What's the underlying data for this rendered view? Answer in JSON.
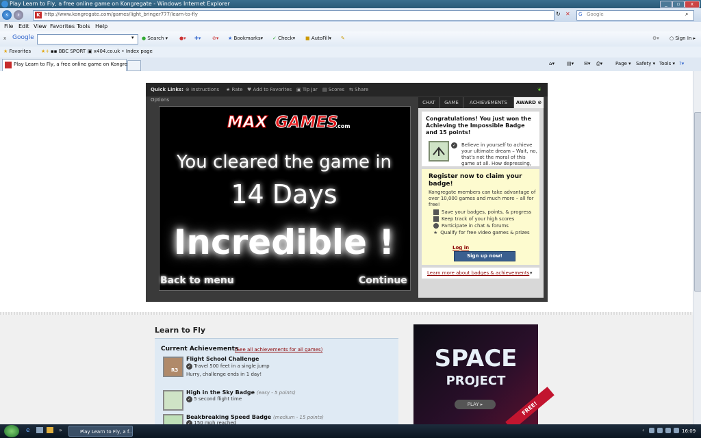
{
  "window": {
    "title": "Play Learn to Fly, a free online game on Kongregate - Windows Internet Explorer"
  },
  "address_bar": {
    "url": "http://www.kongregate.com/games/light_bringer777/learn-to-fly",
    "search_placeholder": "Google"
  },
  "menu": [
    "File",
    "Edit",
    "View",
    "Favorites",
    "Tools",
    "Help"
  ],
  "google_toolbar": {
    "brand": "Google",
    "search_label": "Search",
    "bookmarks_label": "Bookmarks",
    "check_label": "Check",
    "autofill_label": "AutoFill",
    "signin_label": "Sign In"
  },
  "favorites_bar": {
    "favorites_label": "Favorites",
    "links": [
      "BBC SPORT",
      "x404.co.uk • Index page"
    ]
  },
  "tabs": {
    "active_label": "Play Learn to Fly, a free online game on Kongreg...",
    "commands": [
      "Page",
      "Safety",
      "Tools"
    ]
  },
  "quick_links": {
    "label": "Quick Links:",
    "items": [
      "Instructions",
      "Rate",
      "Add to Favorites",
      "Tip Jar",
      "Scores",
      "Share"
    ],
    "options_label": "Options"
  },
  "game": {
    "logo_left": "MAX",
    "logo_right": "GAMES",
    "logo_suffix": ".com",
    "cleared_text": "You cleared the game in",
    "days_text": "14 Days",
    "incredible_text": "Incredible !",
    "back_label": "Back to menu",
    "continue_label": "Continue"
  },
  "side_panel": {
    "tabs": [
      "CHAT",
      "GAME",
      "ACHIEVEMENTS",
      "AWARD"
    ],
    "congrats_heading": "Congratulations! You just won the Achieving the Impossible Badge and 15 points!",
    "badge_desc": "Believe in yourself to achieve your ultimate dream – Wait, no, that's not the moral of this game at all. How depressing,",
    "register_heading": "Register now to claim your badge!",
    "register_text": "Kongregate members can take advantage of over 10,000 games and much more – all for free!",
    "benefits": [
      "Save your badges, points, & progress",
      "Keep track of your high scores",
      "Participate in chat & forums",
      "Qualify for free video games & prizes"
    ],
    "login_label": "Log in",
    "signup_label": "Sign up now!",
    "learn_more_label": "Learn more about badges & achievements"
  },
  "lower": {
    "game_title": "Learn to Fly",
    "achievements_heading": "Current Achievements",
    "achievements_link": "(See all achievements for all games)",
    "achievements": [
      {
        "name": "Flight School Challenge",
        "meta": "",
        "desc": "Travel 500 feet in a single jump",
        "extra": "Hurry, challenge ends in 1 day!",
        "icon_text": "R3"
      },
      {
        "name": "High in the Sky Badge",
        "meta": "(easy - 5 points)",
        "desc": "5 second flight time",
        "extra": "",
        "icon_text": ""
      },
      {
        "name": "Beakbreaking Speed Badge",
        "meta": "(medium - 15 points)",
        "desc": "150 mph reached",
        "extra": "",
        "icon_text": ""
      }
    ]
  },
  "ad": {
    "line1": "SPACE",
    "line2": "PROJECT",
    "play_label": "PLAY",
    "free_label": "FREE!"
  },
  "taskbar": {
    "item_label": "Play Learn to Fly, a f...",
    "clock": "16:09"
  },
  "colors": {
    "kongregate_red": "#c62b2b",
    "signup_blue": "#3a5f8f",
    "register_bg": "#fdfbcf",
    "link_red": "#8b0000"
  }
}
